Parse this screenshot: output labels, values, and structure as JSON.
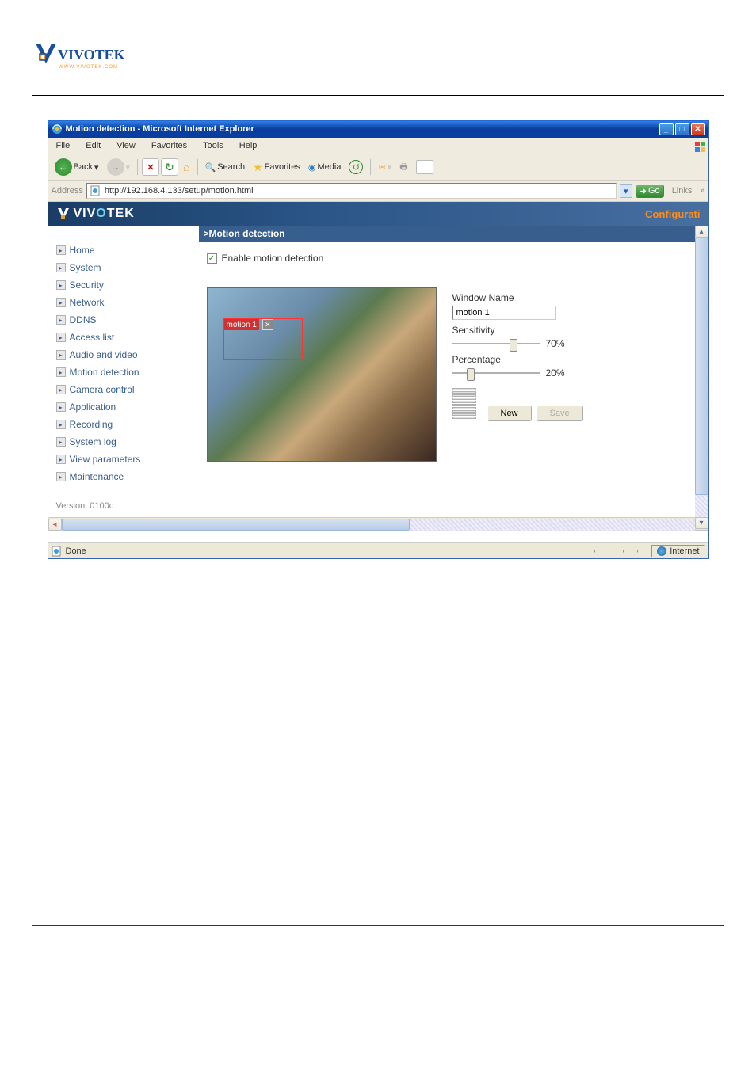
{
  "titlebar": {
    "title": "Motion detection - Microsoft Internet Explorer"
  },
  "menubar": {
    "items": [
      "File",
      "Edit",
      "View",
      "Favorites",
      "Tools",
      "Help"
    ]
  },
  "toolbar": {
    "back": "Back",
    "search": "Search",
    "favorites": "Favorites",
    "media": "Media"
  },
  "addressbar": {
    "label": "Address",
    "url": "http://192.168.4.133/setup/motion.html",
    "go": "Go",
    "links": "Links"
  },
  "header": {
    "brand": "VIVOTEK",
    "config": "Configurati"
  },
  "sidebar": {
    "items": [
      {
        "label": "Home"
      },
      {
        "label": "System"
      },
      {
        "label": "Security"
      },
      {
        "label": "Network"
      },
      {
        "label": "DDNS"
      },
      {
        "label": "Access list"
      },
      {
        "label": "Audio and video"
      },
      {
        "label": "Motion detection"
      },
      {
        "label": "Camera control"
      },
      {
        "label": "Application"
      },
      {
        "label": "Recording"
      },
      {
        "label": "System log"
      },
      {
        "label": "View parameters"
      },
      {
        "label": "Maintenance"
      }
    ],
    "version": "Version: 0100c"
  },
  "main": {
    "section_title": ">Motion detection",
    "enable_label": "Enable motion detection",
    "enable_checked": true,
    "motion_window_label": "motion 1",
    "window_name_label": "Window Name",
    "window_name_value": "motion 1",
    "sensitivity_label": "Sensitivity",
    "sensitivity_value": "70%",
    "percentage_label": "Percentage",
    "percentage_value": "20%",
    "new_btn": "New",
    "save_btn": "Save"
  },
  "statusbar": {
    "done": "Done",
    "zone": "Internet"
  }
}
